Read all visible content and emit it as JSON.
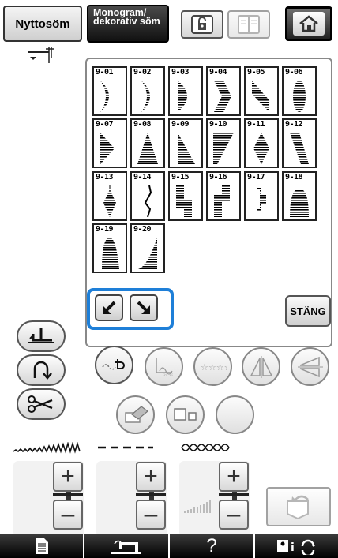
{
  "top_bar": {
    "tab_utility": "Nyttosöm",
    "tab_monogram": "Monogram/ dekorativ söm",
    "icons": [
      "unlock-icon",
      "book-icon",
      "home-icon"
    ]
  },
  "patterns": [
    {
      "label": "9-01",
      "shape": "crescent"
    },
    {
      "label": "9-02",
      "shape": "crescent"
    },
    {
      "label": "9-03",
      "shape": "half-oval"
    },
    {
      "label": "9-04",
      "shape": "chevron"
    },
    {
      "label": "9-05",
      "shape": "slant"
    },
    {
      "label": "9-06",
      "shape": "oval"
    },
    {
      "label": "9-07",
      "shape": "arrow"
    },
    {
      "label": "9-08",
      "shape": "triangle"
    },
    {
      "label": "9-09",
      "shape": "right-triangle"
    },
    {
      "label": "9-10",
      "shape": "wedge"
    },
    {
      "label": "9-11",
      "shape": "diamond"
    },
    {
      "label": "9-12",
      "shape": "slant-bar"
    },
    {
      "label": "9-13",
      "shape": "diamond-small"
    },
    {
      "label": "9-14",
      "shape": "zigzag"
    },
    {
      "label": "9-15",
      "shape": "step-down"
    },
    {
      "label": "9-16",
      "shape": "step-up"
    },
    {
      "label": "9-17",
      "shape": "bracket"
    },
    {
      "label": "9-18",
      "shape": "dome"
    },
    {
      "label": "9-19",
      "shape": "dome-tall"
    },
    {
      "label": "9-20",
      "shape": "curve-ramp"
    }
  ],
  "panel": {
    "close_label": "STÄNG",
    "nav_icons": [
      "arrow-down-left-icon",
      "arrow-down-right-icon"
    ]
  },
  "side_buttons": [
    "presser-foot-icon",
    "reverse-stitch-icon",
    "scissors-icon"
  ],
  "edit_buttons": [
    "thread-pattern-icon",
    "stitch-edit-icon",
    "stars-icon",
    "mirror-icon",
    "flip-icon",
    "eraser-icon",
    "size-icon",
    "empty-slot"
  ],
  "adjusters": {
    "labels_icons": [
      "width-icon",
      "length-icon",
      "density-icon"
    ],
    "plus": "+",
    "minus": "–"
  },
  "bottom_bar": {
    "help": "?",
    "icons": [
      "document-icon",
      "sewing-machine-icon",
      "help-icon",
      "settings-icon"
    ]
  },
  "colors": {
    "accent": "#1e7fd8",
    "dark": "#222222"
  }
}
